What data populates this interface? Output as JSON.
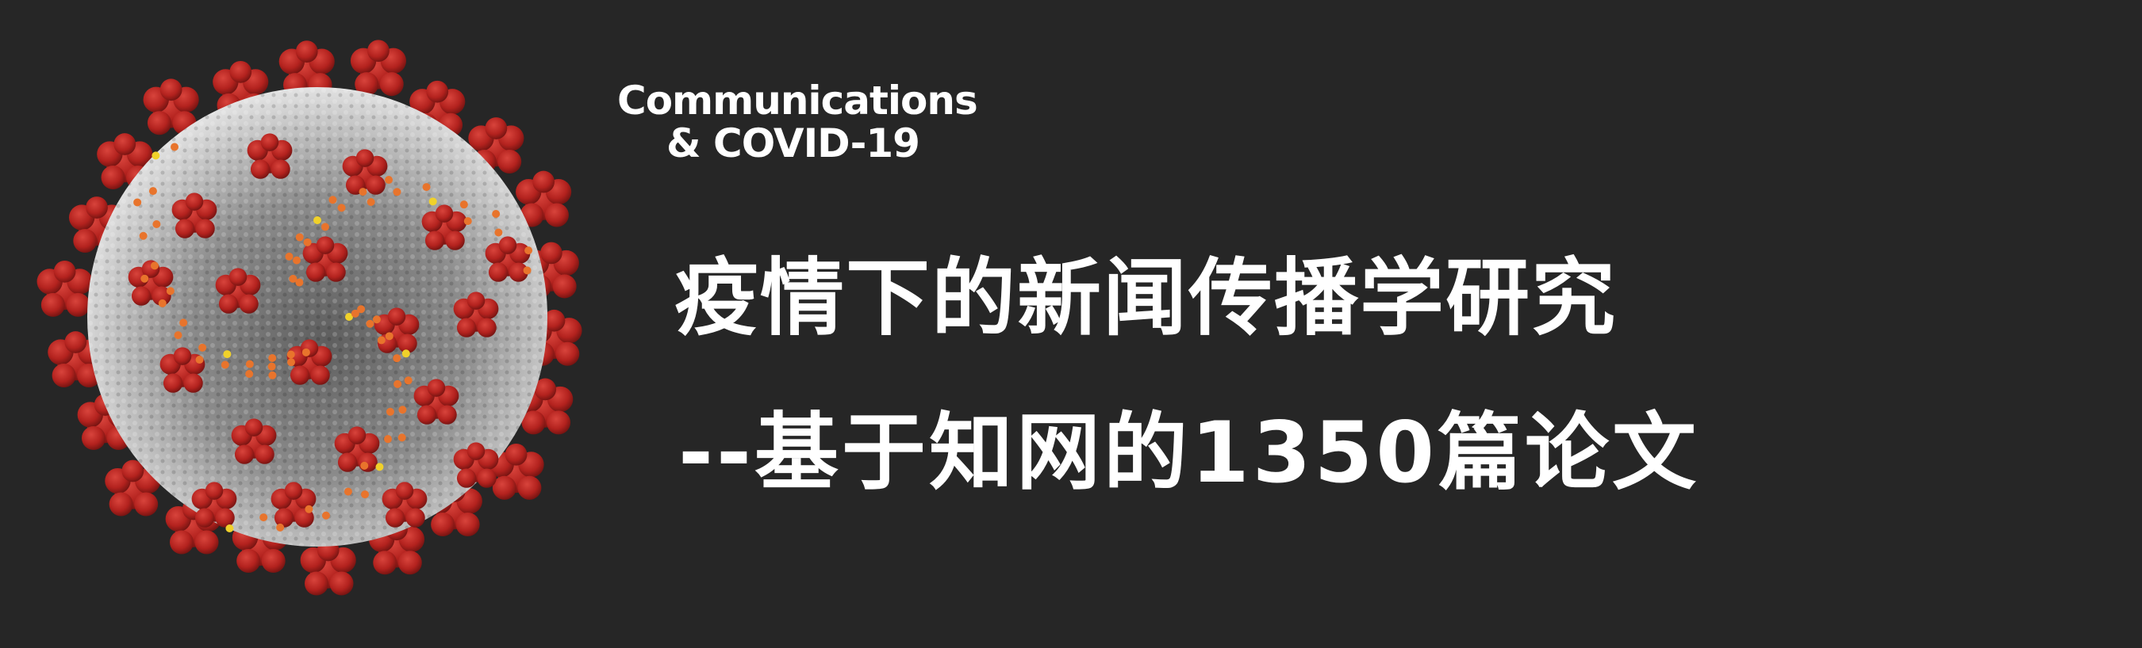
{
  "header": {
    "label_line_1": "Communications",
    "label_line_2": "& COVID-19"
  },
  "main": {
    "title_line_1": "疫情下的新闻传播学研究",
    "title_line_2": "--基于知网的1350篇论文"
  },
  "colors": {
    "background": "#262626",
    "text": "#ffffff",
    "spike_red": "#b3221e",
    "virus_surface": "#9a9a9a",
    "accent_orange": "#e8742c",
    "accent_yellow": "#f0d12a"
  },
  "image": {
    "icon": "coronavirus-illustration"
  }
}
